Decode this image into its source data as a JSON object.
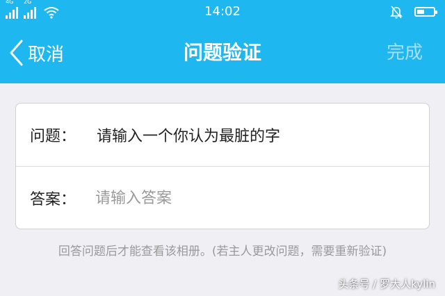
{
  "status_bar": {
    "sim1_label": "4G",
    "sim2_label": "2G",
    "time": "14:02"
  },
  "nav": {
    "back_label": "取消",
    "title": "问题验证",
    "done_label": "完成"
  },
  "form": {
    "question_label": "问题：",
    "question_text": "请输入一个你认为最脏的字",
    "answer_label": "答案：",
    "answer_placeholder": "请输入答案",
    "answer_value": ""
  },
  "hint": "回答问题后才能查看该相册。(若主人更改问题，需要重新验证)",
  "watermark": "头条号 / 罗大人kylin",
  "colors": {
    "accent": "#1fb7f0",
    "done_disabled": "#a8dff6",
    "page_background": "#efeff4",
    "hint_text": "#9a9a9a"
  },
  "icons": [
    "signal-icon",
    "wifi-icon",
    "muted-bell-icon",
    "battery-icon",
    "back-chevron-icon"
  ]
}
